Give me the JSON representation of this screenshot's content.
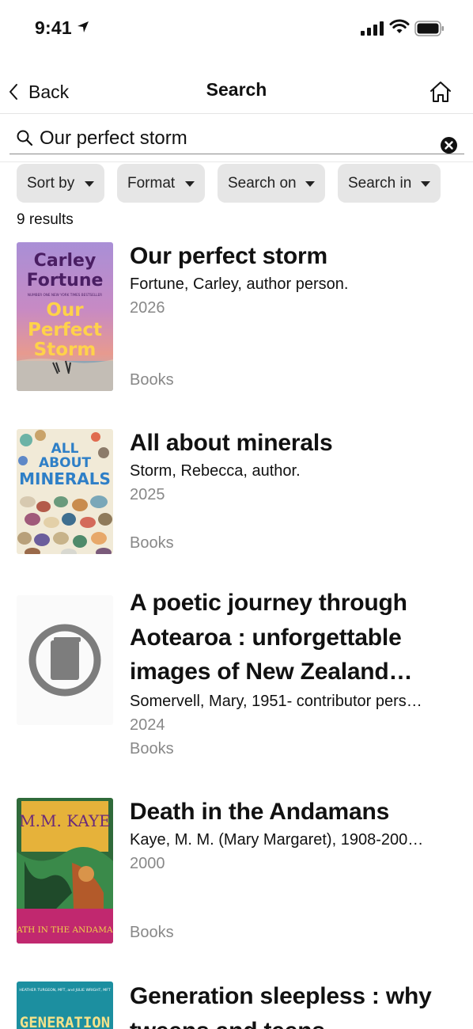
{
  "status_bar": {
    "time": "9:41"
  },
  "nav": {
    "back_label": "Back",
    "title": "Search"
  },
  "search": {
    "value": "Our perfect storm"
  },
  "filters": [
    {
      "label": "Sort by"
    },
    {
      "label": "Format"
    },
    {
      "label": "Search on"
    },
    {
      "label": "Search in"
    }
  ],
  "results_count": "9 results",
  "results": [
    {
      "title": "Our perfect storm",
      "author": "Fortune, Carley, author person.",
      "year": "2026",
      "format": "Books",
      "cover_text": {
        "line1": "Carley",
        "line2": "Fortune",
        "tag": "NUMBER ONE NEW YORK TIMES BESTSELLER",
        "t1": "Our",
        "t2": "Perfect",
        "t3": "Storm"
      }
    },
    {
      "title": "All about minerals",
      "author": "Storm, Rebecca, author.",
      "year": "2025",
      "format": "Books",
      "cover_text": {
        "line1": "ALL",
        "line2": "ABOUT",
        "line3": "MINERALS"
      }
    },
    {
      "title": "A poetic journey through Aotearoa : unforgettable images of New Zealand…",
      "author": "Somervell, Mary, 1951- contributor pers…",
      "year": "2024",
      "format": "Books"
    },
    {
      "title": "Death in the Andamans",
      "author": "Kaye, M. M. (Mary Margaret), 1908-200…",
      "year": "2000",
      "format": "Books",
      "cover_text": {
        "author": "M.M. KAYE",
        "title": "DEATH IN THE ANDAMANS"
      }
    },
    {
      "title": "Generation sleepless : why tweens and teens…",
      "cover_text": {
        "authors": "HEATHER TURGEON, MFT, and JULIE WRIGHT, MFT",
        "title": "GENERATION"
      }
    }
  ]
}
